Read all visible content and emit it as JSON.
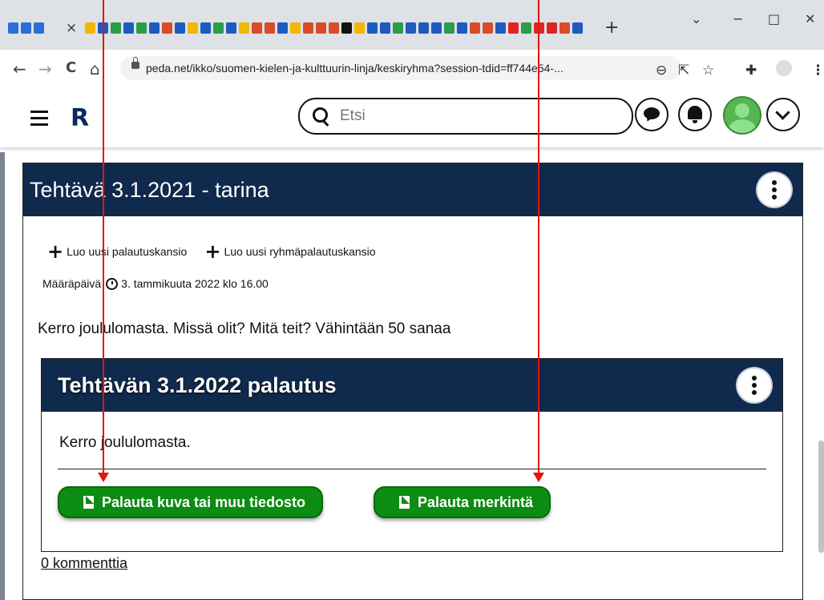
{
  "browser": {
    "url": "peda.net/ikko/suomen-kielen-ja-kulttuurin-linja/keskiryhma?session-tdid=ff744e54-...",
    "tab_close": "×",
    "new_tab": "+",
    "window_controls": [
      "⌄",
      "−",
      "□",
      "✕"
    ],
    "nav": [
      "←",
      "→",
      "C",
      "⌂"
    ],
    "toolbar_icons": [
      "zoom-icon",
      "share-icon",
      "star-icon",
      "extensions-icon",
      "profile-icon",
      "menu-icon"
    ]
  },
  "header": {
    "logo": "R",
    "search_placeholder": "Etsi"
  },
  "task": {
    "title": "Tehtävä 3.1.2021 - tarina",
    "new_folder": "Luo uusi palautuskansio",
    "new_group_folder": "Luo uusi ryhmäpalautuskansio",
    "deadline_label": "Määräpäivä",
    "deadline_value": "3. tammikuuta 2022 klo 16.00",
    "description": "Kerro joululomasta. Missä olit? Mitä teit? Vähintään 50 sanaa"
  },
  "submission": {
    "title": "Tehtävän 3.1.2022 palautus",
    "text": "Kerro joululomasta.",
    "upload_button": "Palauta kuva tai muu tiedosto",
    "entry_button": "Palauta merkintä"
  },
  "comments": "0 kommenttia",
  "colors": {
    "header_navy": "#0f2a4d",
    "button_green": "#0c8c12",
    "annotation_red": "#e8140c"
  }
}
